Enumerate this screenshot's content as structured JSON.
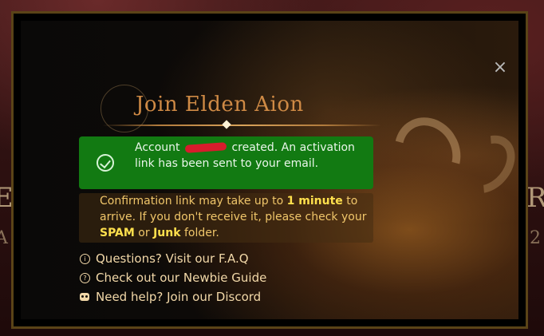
{
  "background": {
    "left_letter": "E",
    "right_letter": "R",
    "left_letter_2": "A",
    "right_letter_2": "2"
  },
  "modal": {
    "title": "Join Elden Aion",
    "close_label": "×",
    "success": {
      "prefix": "Account",
      "suffix": "created. An activation link has been sent to your email."
    },
    "info": {
      "part1": "Confirmation link may take up to ",
      "part2": "1 minute",
      "part3": " to arrive. If you don't receive it, please check your ",
      "part4": "SPAM",
      "part5": " or ",
      "part6": "Junk",
      "part7": " folder."
    },
    "links": [
      {
        "label": "Questions? Visit our F.A.Q",
        "icon": "info-icon"
      },
      {
        "label": "Check out our Newbie Guide",
        "icon": "help-icon"
      },
      {
        "label": "Need help? Join our Discord",
        "icon": "discord-icon"
      }
    ]
  },
  "colors": {
    "title": "#cf8a45",
    "success_bg": "#127a12",
    "info_text": "#f0c66a",
    "info_highlight": "#ffe04d"
  }
}
